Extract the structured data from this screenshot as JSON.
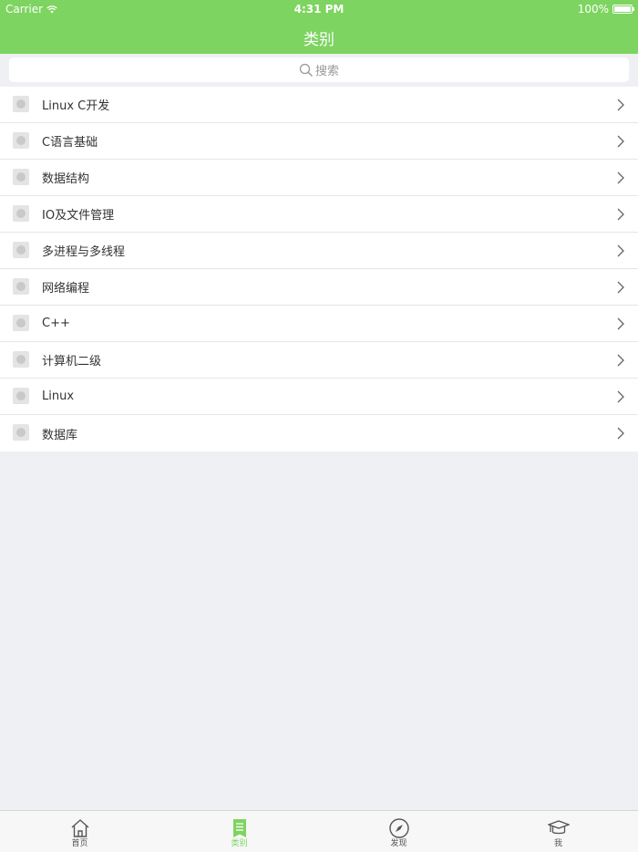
{
  "status": {
    "carrier": "Carrier",
    "time": "4:31 PM",
    "battery": "100%",
    "battery_level": 1.0
  },
  "nav": {
    "title": "类别"
  },
  "search": {
    "placeholder": "搜索"
  },
  "categories": [
    {
      "label": "Linux C开发"
    },
    {
      "label": "C语言基础"
    },
    {
      "label": "数据结构"
    },
    {
      "label": "IO及文件管理"
    },
    {
      "label": "多进程与多线程"
    },
    {
      "label": "网络编程"
    },
    {
      "label": "C++"
    },
    {
      "label": "计算机二级"
    },
    {
      "label": "Linux"
    },
    {
      "label": "数据库"
    }
  ],
  "tabbar": {
    "tabs": [
      {
        "label": "首页",
        "icon": "home-icon"
      },
      {
        "label": "类别",
        "icon": "category-list-icon",
        "active": true
      },
      {
        "label": "发现",
        "icon": "compass-icon"
      },
      {
        "label": "我",
        "icon": "graduation-cap-icon"
      }
    ]
  },
  "colors": {
    "accent": "#7dd460",
    "background": "#eff0f4"
  }
}
